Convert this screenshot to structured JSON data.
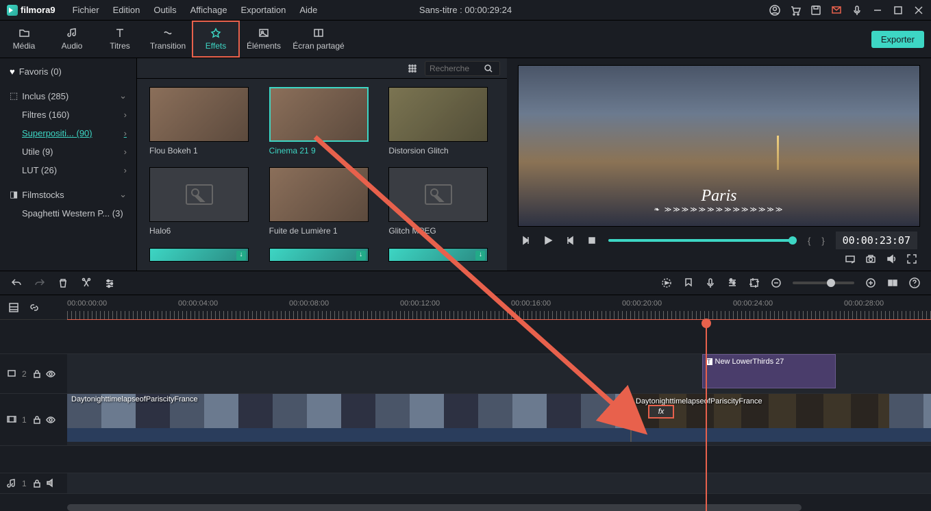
{
  "app": {
    "name": "filmora",
    "ver": "9"
  },
  "menu": [
    "Fichier",
    "Edition",
    "Outils",
    "Affichage",
    "Exportation",
    "Aide"
  ],
  "title": "Sans-titre : 00:00:29:24",
  "tabs": [
    {
      "label": "Média"
    },
    {
      "label": "Audio"
    },
    {
      "label": "Titres"
    },
    {
      "label": "Transition"
    },
    {
      "label": "Effets"
    },
    {
      "label": "Éléments"
    },
    {
      "label": "Écran partagé"
    }
  ],
  "export_label": "Exporter",
  "sidebar": {
    "favorites": "Favoris (0)",
    "included": "Inclus (285)",
    "filtres": "Filtres (160)",
    "superpos": "Superpositi... (90)",
    "utile": "Utile (9)",
    "lut": "LUT (26)",
    "filmstocks": "Filmstocks",
    "spaghetti": "Spaghetti Western P... (3)"
  },
  "search_placeholder": "Recherche",
  "effects": [
    {
      "label": "Flou Bokeh 1",
      "sel": false,
      "ph": false
    },
    {
      "label": "Cinema 21 9",
      "sel": true,
      "ph": false
    },
    {
      "label": "Distorsion Glitch",
      "sel": false,
      "ph": false
    },
    {
      "label": "Halo6",
      "sel": false,
      "ph": true
    },
    {
      "label": "Fuite de Lumière 1",
      "sel": false,
      "ph": false
    },
    {
      "label": "Glitch MPEG",
      "sel": false,
      "ph": true
    }
  ],
  "preview": {
    "paris": "Paris",
    "time": "00:00:23:07"
  },
  "timeline": {
    "marks": [
      "00:00:00:00",
      "00:00:04:00",
      "00:00:08:00",
      "00:00:12:00",
      "00:00:16:00",
      "00:00:20:00",
      "00:00:24:00",
      "00:00:28:00"
    ],
    "title_clip": "New LowerThirds 27",
    "video_clip": "DaytonighttimelapseofPariscityFrance",
    "video_clip2": "DaytonighttimelapseofPariscityFrance",
    "track1": "2",
    "track2": "1",
    "track3": "1",
    "fx": "fx"
  }
}
